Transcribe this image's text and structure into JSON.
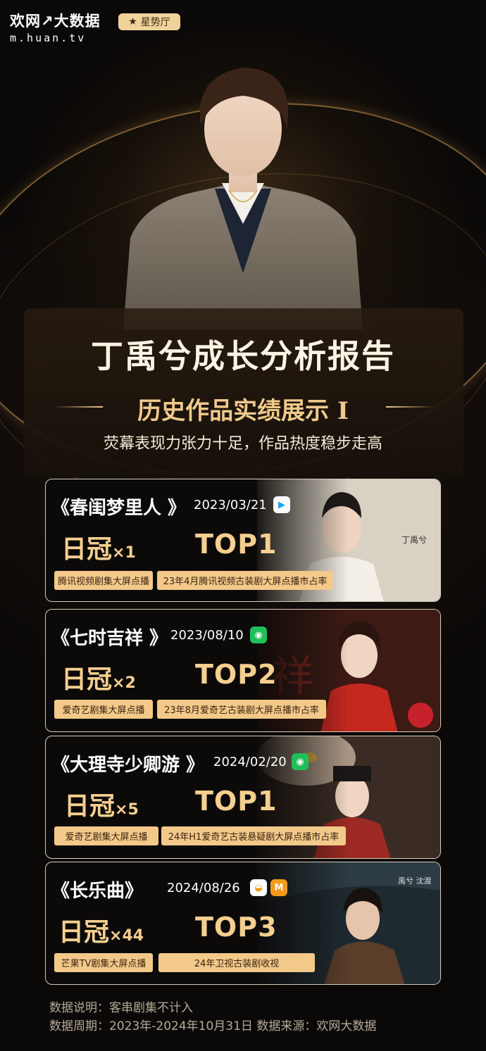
{
  "header": {
    "logo_name": "欢网↗大数据",
    "logo_url": "m.huan.tv",
    "badge_label": "星势厅"
  },
  "report": {
    "title": "丁禹兮成长分析报告",
    "section_title": "历史作品实绩展示 I",
    "tagline": "荧幕表现力张力十足，作品热度稳步走高"
  },
  "works": [
    {
      "title": "《春闺梦里人 》",
      "date": "2023/03/21",
      "platform_icons": [
        "tencent-video-icon"
      ],
      "crown_label": "日冠",
      "crown_count": "×1",
      "rank": "TOP1",
      "tags": [
        "腾讯视频剧集大屏点播",
        "23年4月腾讯视频古装剧大屏点播市占率"
      ]
    },
    {
      "title": "《七时吉祥 》",
      "date": "2023/08/10",
      "platform_icons": [
        "iqiyi-icon"
      ],
      "crown_label": "日冠",
      "crown_count": "×2",
      "rank": "TOP2",
      "tags": [
        "爱奇艺剧集大屏点播",
        "23年8月爱奇艺古装剧大屏点播市占率"
      ]
    },
    {
      "title": "《大理寺少卿游 》",
      "date": "2024/02/20",
      "platform_icons": [
        "iqiyi-icon"
      ],
      "crown_label": "日冠",
      "crown_count": "×5",
      "rank": "TOP1",
      "tags": [
        "爱奇艺剧集大屏点播",
        "24年H1爱奇艺古装悬疑剧大屏点播市占率"
      ]
    },
    {
      "title": "《长乐曲》",
      "date": "2024/08/26",
      "platform_icons": [
        "hunan-tv-icon",
        "mango-tv-icon"
      ],
      "crown_label": "日冠",
      "crown_count": "×44",
      "rank": "TOP3",
      "tags": [
        "芒果TV剧集大屏点播",
        "24年卫视古装剧收视"
      ]
    }
  ],
  "footer": {
    "note": "数据说明：客串剧集不计入",
    "period": "数据周期：2023年-2024年10月31日   数据来源：欢网大数据"
  },
  "colors": {
    "accent": "#f5cf8f",
    "tag_bg": "#f3c98a",
    "background": "#0b0908"
  }
}
